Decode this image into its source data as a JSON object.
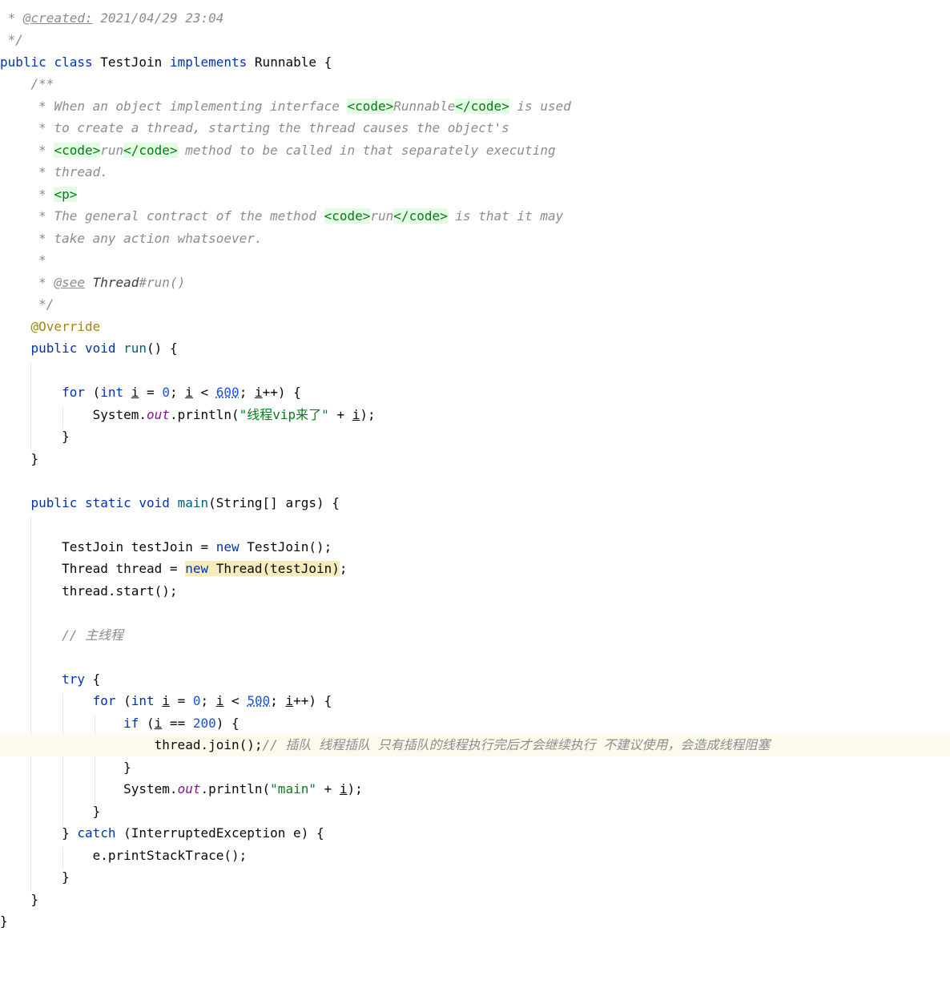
{
  "editor": {
    "header": {
      "created_star": " * ",
      "created_tag": "@created:",
      "created_value": " 2021/04/29 23:04",
      "doc_end": " */"
    },
    "class_decl": {
      "kw_public": "public",
      "kw_class": "class",
      "name": "TestJoin",
      "kw_implements": "implements",
      "iface": "Runnable",
      "brace": " {"
    },
    "javadoc": {
      "open": "/**",
      "l1_pre": "* When an object implementing interface ",
      "l1_tag1": "<code>",
      "l1_word": "Runnable",
      "l1_tag2": "</code>",
      "l1_post": " is used",
      "l2": "* to create a thread, starting the thread causes the object's",
      "l3_star": "* ",
      "l3_tag1": "<code>",
      "l3_word": "run",
      "l3_tag2": "</code>",
      "l3_post": " method to be called in that separately executing",
      "l4": "* thread.",
      "l5_star": "* ",
      "l5_tag": "<p>",
      "l6_pre": "* The general contract of the method ",
      "l6_tag1": "<code>",
      "l6_word": "run",
      "l6_tag2": "</code>",
      "l6_post": " is that it may",
      "l7": "* take any action whatsoever.",
      "l8": "*",
      "l9_star": "* ",
      "l9_tag": "@see",
      "l9_class": " Thread",
      "l9_rest": "#run()",
      "close": "*/"
    },
    "run_method": {
      "annotation": "@Override",
      "kw_public": "public",
      "kw_void": "void",
      "name": "run",
      "tail": "() {",
      "for_kw": "for",
      "for_open": " (",
      "int_kw": "int",
      "var_i": "i",
      "eq0": " = ",
      "zero": "0",
      "semi": "; ",
      "lt": " < ",
      "limit": "600",
      "inc": "++) {",
      "sys": "System.",
      "out": "out",
      "println": ".println(",
      "str": "\"线程vip来了\"",
      "plus": " + ",
      "end": ");",
      "close_for": "}",
      "close_method": "}"
    },
    "main_method": {
      "kw_public": "public",
      "kw_static": "static",
      "kw_void": "void",
      "name": "main",
      "params": "(String[] args) {",
      "l1_type": "TestJoin testJoin = ",
      "l1_new": "new",
      "l1_rest": " TestJoin();",
      "l2_type": "Thread thread = ",
      "l2_new": "new",
      "l2_rest": " Thread(testJoin)",
      "l2_semi": ";",
      "l3": "thread.start();",
      "comment_main": "// 主线程",
      "try_kw": "try",
      "try_brace": " {",
      "for_kw": "for",
      "for_open": " (",
      "int_kw": "int",
      "var_i": "i",
      "eq0": " = ",
      "zero": "0",
      "semi": "; ",
      "lt": " < ",
      "limit": "500",
      "inc": "++) {",
      "if_kw": "if",
      "if_open": " (",
      "if_eq": " == ",
      "if_val": "200",
      "if_close": ") {",
      "join_code": "thread.join();",
      "join_comment": "// 插队 线程插队 只有插队的线程执行完后才会继续执行 不建议使用，会造成线程阻塞",
      "close_if": "}",
      "sys": "System.",
      "out": "out",
      "println": ".println(",
      "str": "\"main\"",
      "plus": " + ",
      "end": ");",
      "close_for": "}",
      "catch_open": "} ",
      "catch_kw": "catch",
      "catch_rest": " (InterruptedException e) {",
      "stack": "e.printStackTrace();",
      "close_catch": "}",
      "close_method": "}"
    },
    "class_close": "}",
    "colors": {
      "keyword": "#0033b3",
      "method": "#00627a",
      "number": "#1750eb",
      "string": "#067d17",
      "comment": "#8c8c8c",
      "annotation": "#9e880d",
      "static_field": "#871094",
      "caret_line": "#fcfaed",
      "usage_highlight": "#f6ebbc"
    }
  }
}
